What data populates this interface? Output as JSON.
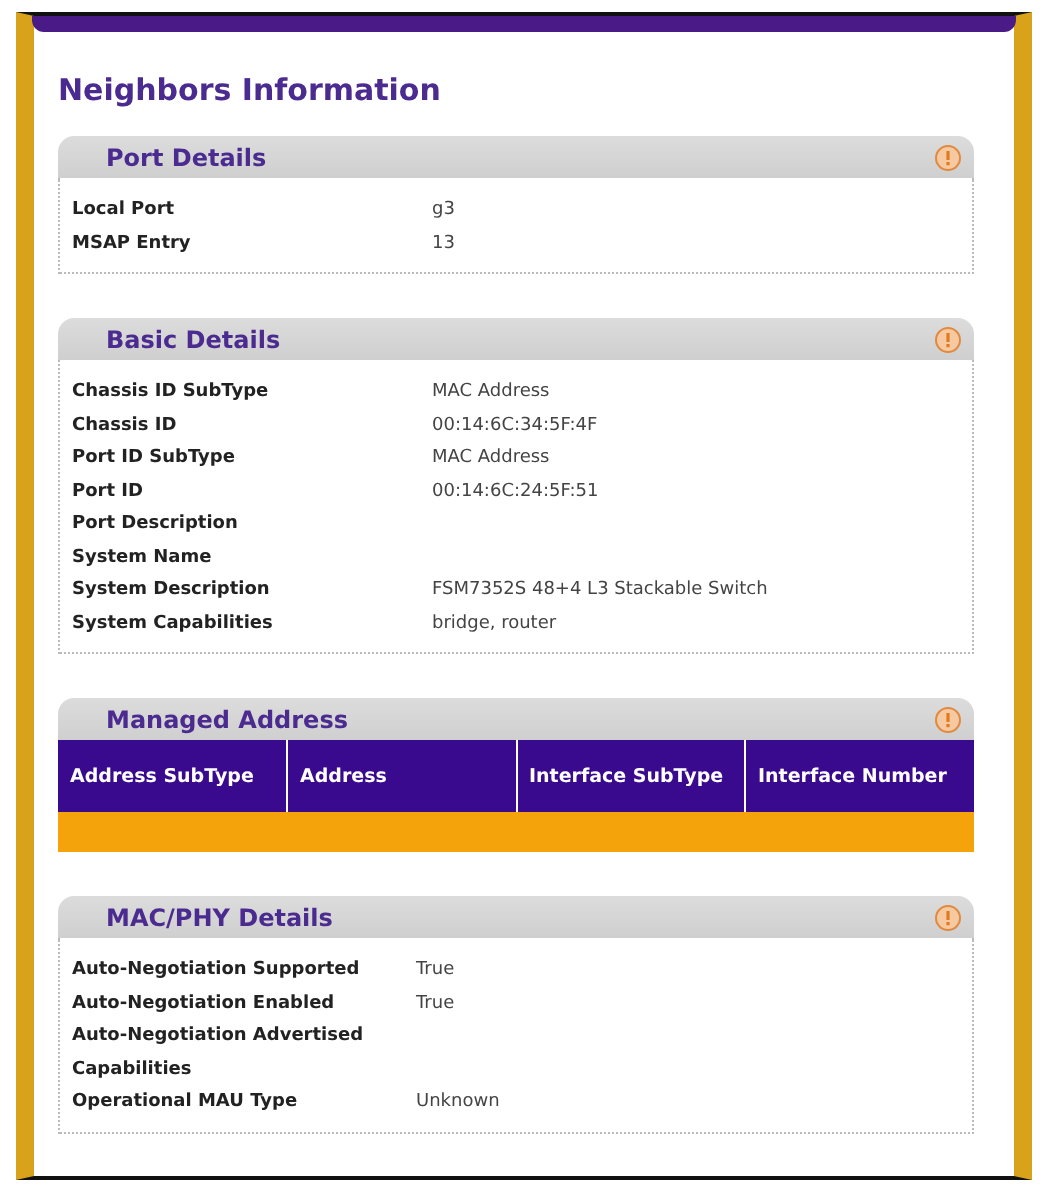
{
  "page": {
    "title": "Neighbors Information"
  },
  "sections": [
    {
      "kind": "details",
      "title": "Port Details",
      "rows": [
        {
          "label": "Local Port",
          "value": "g3"
        },
        {
          "label": "MSAP Entry",
          "value": "13"
        }
      ]
    },
    {
      "kind": "details",
      "title": "Basic Details",
      "rows": [
        {
          "label": "Chassis ID SubType",
          "value": "MAC Address"
        },
        {
          "label": "Chassis ID",
          "value": "00:14:6C:34:5F:4F"
        },
        {
          "label": "Port ID SubType",
          "value": "MAC Address"
        },
        {
          "label": "Port ID",
          "value": "00:14:6C:24:5F:51"
        },
        {
          "label": "Port Description"
        },
        {
          "label": "System Name"
        },
        {
          "label": "System Description",
          "value": "FSM7352S 48+4 L3 Stackable Switch"
        },
        {
          "label": "System Capabilities",
          "value": "bridge, router"
        }
      ]
    },
    {
      "kind": "table",
      "title": "Managed Address",
      "columns": [
        "Address SubType",
        "Address",
        "Interface SubType",
        "Interface Number"
      ],
      "rows": [
        {
          "selected": true
        }
      ]
    },
    {
      "kind": "details",
      "title": "MAC/PHY Details",
      "rows": [
        {
          "label": "Auto-Negotiation Supported",
          "value": "True"
        },
        {
          "label": "Auto-Negotiation Enabled",
          "value": "True"
        },
        {
          "label": "Auto-Negotiation Advertised Capabilities"
        },
        {
          "label": "Operational MAU Type",
          "value": "Unknown"
        }
      ]
    }
  ]
}
